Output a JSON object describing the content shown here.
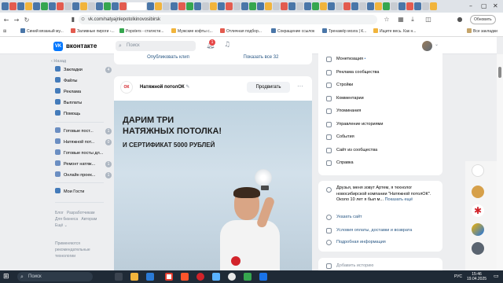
{
  "browser": {
    "url": "vk.com/natyajnlepotolkinovosibirsk",
    "update_label": "Обновить",
    "bookmarks": [
      "Синий вязаный му...",
      "Заливные пироги -...",
      "Popsters - статисти...",
      "Мужские кофты с...",
      "Отличная подбор...",
      "Сокращение ссылок",
      "Тренажёр мозга | К...",
      "Ищите весь. Как н..."
    ],
    "all_bookmarks": "Все закладки"
  },
  "vk": {
    "logo_text": "вконтакте",
    "logo_mark": "VK",
    "search_placeholder": "Поиск",
    "notif_count": "1",
    "back_label": "Назад"
  },
  "leftnav": {
    "items": [
      {
        "label": "Закладки",
        "count": "4"
      },
      {
        "label": "Файлы",
        "count": ""
      },
      {
        "label": "Реклама",
        "count": ""
      },
      {
        "label": "Выплаты",
        "count": ""
      },
      {
        "label": "Помощь",
        "count": ""
      }
    ],
    "groups": [
      {
        "label": "Готовые пост...",
        "count": "1"
      },
      {
        "label": "Натяжной пот...",
        "count": "0"
      },
      {
        "label": "Готовые посты дл...",
        "count": ""
      },
      {
        "label": "Ремонт натяж...",
        "count": "1"
      },
      {
        "label": "Онлайн проек...",
        "count": "1"
      }
    ],
    "my_games": "Мои Гости",
    "footer": [
      "Блог",
      "Разработчикам",
      "Для бизнеса",
      "Авторам",
      "Ещё"
    ],
    "rec_text": "Применяются рекомендательные технологии"
  },
  "post": {
    "publish_clip": "Опубликовать клип",
    "show_all": "Показать все 32",
    "group_name": "Натяжной потолОК",
    "promote_btn": "Продвигать",
    "ad_line1": "ДАРИМ ТРИ",
    "ad_line2": "НАТЯЖНЫХ ПОТОЛКА!",
    "ad_line3": "И СЕРТИФИКАТ 5000 РУБЛЕЙ"
  },
  "rightmenu": {
    "items": [
      "Монетизация",
      "Реклама сообщества",
      "Стройки",
      "Комментарии",
      "Упоминания",
      "Управление историями",
      "События",
      "Сайт из сообщества",
      "Справка"
    ]
  },
  "about": {
    "text": "Друзья, меня зовут Артем, я технолог новосибирской компании \"Натяжной потолОК\". Около 10 лет я был м...",
    "more": "Показать ещё",
    "site_link": "Указать сайт",
    "terms": "Условия оплаты, доставки и возврата",
    "details": "Подробная информация",
    "add_story": "Добавить историю"
  },
  "taskbar": {
    "search": "Поиск",
    "lang": "РУС",
    "time": "15:46",
    "date": "19.04.2025"
  }
}
